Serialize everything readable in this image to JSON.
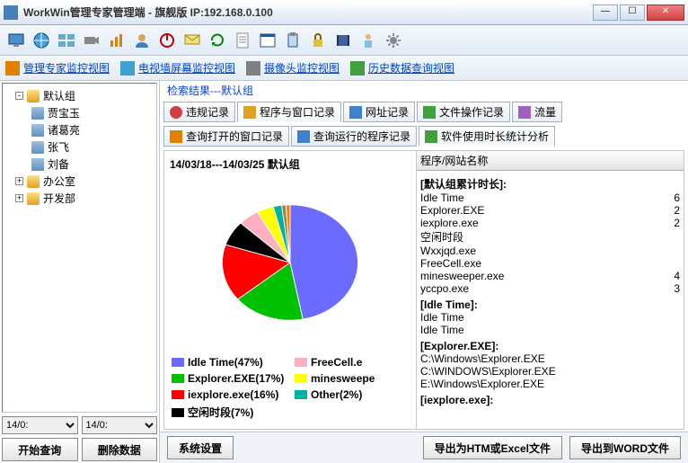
{
  "window": {
    "title": "WorkWin管理专家管理端 - 旗舰版 IP:192.168.0.100"
  },
  "view_tabs": [
    {
      "label": "管理专家监控视图"
    },
    {
      "label": "电视墙屏幕监控视图"
    },
    {
      "label": "摄像头监控视图"
    },
    {
      "label": "历史数据查询视图"
    }
  ],
  "tree": {
    "root": "默认组",
    "children": [
      "贾宝玉",
      "诸葛亮",
      "张飞",
      "刘备"
    ],
    "other_groups": [
      "办公室",
      "开发部"
    ]
  },
  "date": {
    "from": "14/0:",
    "to": "14/0:"
  },
  "left_buttons": {
    "query": "开始查询",
    "delete": "删除数据"
  },
  "search_header": "检索结果---默认组",
  "rec_tabs_row1": [
    "违规记录",
    "程序与窗口记录",
    "网址记录",
    "文件操作记录",
    "流量"
  ],
  "rec_tabs_row2": [
    "查询打开的窗口记录",
    "查询运行的程序记录",
    "软件使用时长统计分析"
  ],
  "chart_header": "14/03/18---14/03/25  默认组",
  "list_header": {
    "c1": "程序/网站名称"
  },
  "groups": [
    {
      "title": "[默认组累计时长]:",
      "items": [
        {
          "name": "Idle Time",
          "v": "6"
        },
        {
          "name": "Explorer.EXE",
          "v": "2"
        },
        {
          "name": "iexplore.exe",
          "v": "2"
        },
        {
          "name": "空闲时段",
          "v": ""
        },
        {
          "name": "Wxxjqd.exe",
          "v": ""
        },
        {
          "name": "FreeCell.exe",
          "v": ""
        },
        {
          "name": "minesweeper.exe",
          "v": "4"
        },
        {
          "name": "yccpo.exe",
          "v": "3"
        }
      ]
    },
    {
      "title": "[Idle Time]:",
      "items": [
        {
          "name": "Idle Time",
          "v": ""
        },
        {
          "name": "Idle Time",
          "v": ""
        }
      ]
    },
    {
      "title": "[Explorer.EXE]:",
      "items": [
        {
          "name": "C:\\Windows\\Explorer.EXE",
          "v": ""
        },
        {
          "name": "C:\\WINDOWS\\Explorer.EXE",
          "v": ""
        },
        {
          "name": "E:\\Windows\\Explorer.EXE",
          "v": ""
        }
      ]
    },
    {
      "title": "[iexplore.exe]:",
      "items": []
    }
  ],
  "footer": {
    "sys": "系统设置",
    "export_htm": "导出为HTM或Excel文件",
    "export_word": "导出到WORD文件"
  },
  "chart_data": {
    "type": "pie",
    "title": "14/03/18---14/03/25  默认组",
    "series": [
      {
        "name": "Idle Time",
        "value": 47,
        "color": "#6b6bff",
        "label": "Idle Time(47%)"
      },
      {
        "name": "Explorer.EXE",
        "value": 17,
        "color": "#00c000",
        "label": "Explorer.EXE(17%)"
      },
      {
        "name": "iexplore.exe",
        "value": 16,
        "color": "#ff0000",
        "label": "iexplore.exe(16%)"
      },
      {
        "name": "空闲时段",
        "value": 7,
        "color": "#000000",
        "label": "空闲时段(7%)"
      },
      {
        "name": "FreeCell.exe",
        "value": 5,
        "color": "#ffb0c0",
        "label": "FreeCell.e"
      },
      {
        "name": "minesweeper.exe",
        "value": 4,
        "color": "#ffff00",
        "label": "minesweepe"
      },
      {
        "name": "Other",
        "value": 2,
        "color": "#00b0a0",
        "label": "Other(2%)"
      },
      {
        "name": "x1",
        "value": 1,
        "color": "#a08040",
        "label": ""
      },
      {
        "name": "x2",
        "value": 1,
        "color": "#ff8000",
        "label": ""
      }
    ]
  }
}
